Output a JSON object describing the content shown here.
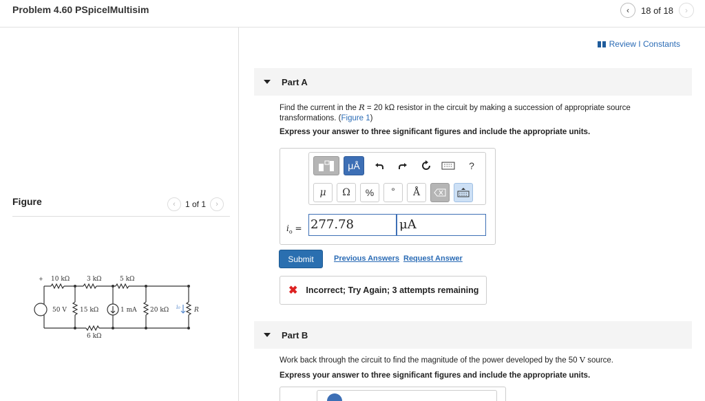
{
  "header": {
    "title": "Problem 4.60 PSpicelMultisim",
    "prev_icon": "chevron-left-icon",
    "next_icon": "chevron-right-icon",
    "pager_text": "18 of 18"
  },
  "figure": {
    "heading": "Figure",
    "pager_text": "1 of 1",
    "circuit": {
      "r1": "10 kΩ",
      "r2": "3 kΩ",
      "r3": "5 kΩ",
      "source_v": "50 V",
      "r4": "15 kΩ",
      "source_i": "1 mA",
      "r5": "20 kΩ",
      "current_label": "i₀",
      "r_label": "R",
      "r6": "6 kΩ"
    }
  },
  "review": {
    "label": "Review I Constants",
    "icon": "review-bars-icon"
  },
  "part_a": {
    "label": "Part A",
    "question_pre": "Find the current in the ",
    "question_var": "R",
    "question_mid": " = 20  kΩ resistor in the circuit by making a succession of appropriate source transformations. (",
    "figure_link": "Figure 1",
    "question_post": ")",
    "instruction": "Express your answer to three significant figures and include the appropriate units.",
    "toolbar": {
      "templates_icon": "templates-icon",
      "units_btn": "μÅ",
      "undo_icon": "undo-icon",
      "redo_icon": "redo-icon",
      "reset_icon": "reset-icon",
      "keyboard_icon": "keyboard-icon",
      "help_btn": "?",
      "mu_btn": "μ",
      "omega_btn": "Ω",
      "percent_btn": "%",
      "degree_btn": "°",
      "angstrom_btn": "Å",
      "backspace_icon": "backspace-icon",
      "keyboard_toggle_icon": "keyboard-toggle-icon"
    },
    "answer_label_var": "i",
    "answer_label_sub": "o",
    "answer_label_eq": " =",
    "answer_value": "277.78",
    "answer_unit": "μA",
    "submit_label": "Submit",
    "previous_answers": "Previous Answers",
    "request_answer": "Request Answer",
    "feedback_icon": "x-icon",
    "feedback_text": "Incorrect; Try Again; 3 attempts remaining"
  },
  "part_b": {
    "label": "Part B",
    "question_pre": "Work back through the circuit to find the magnitude of the power developed by the 50 ",
    "question_unit": "V",
    "question_post": " source.",
    "instruction": "Express your answer to three significant figures and include the appropriate units."
  }
}
